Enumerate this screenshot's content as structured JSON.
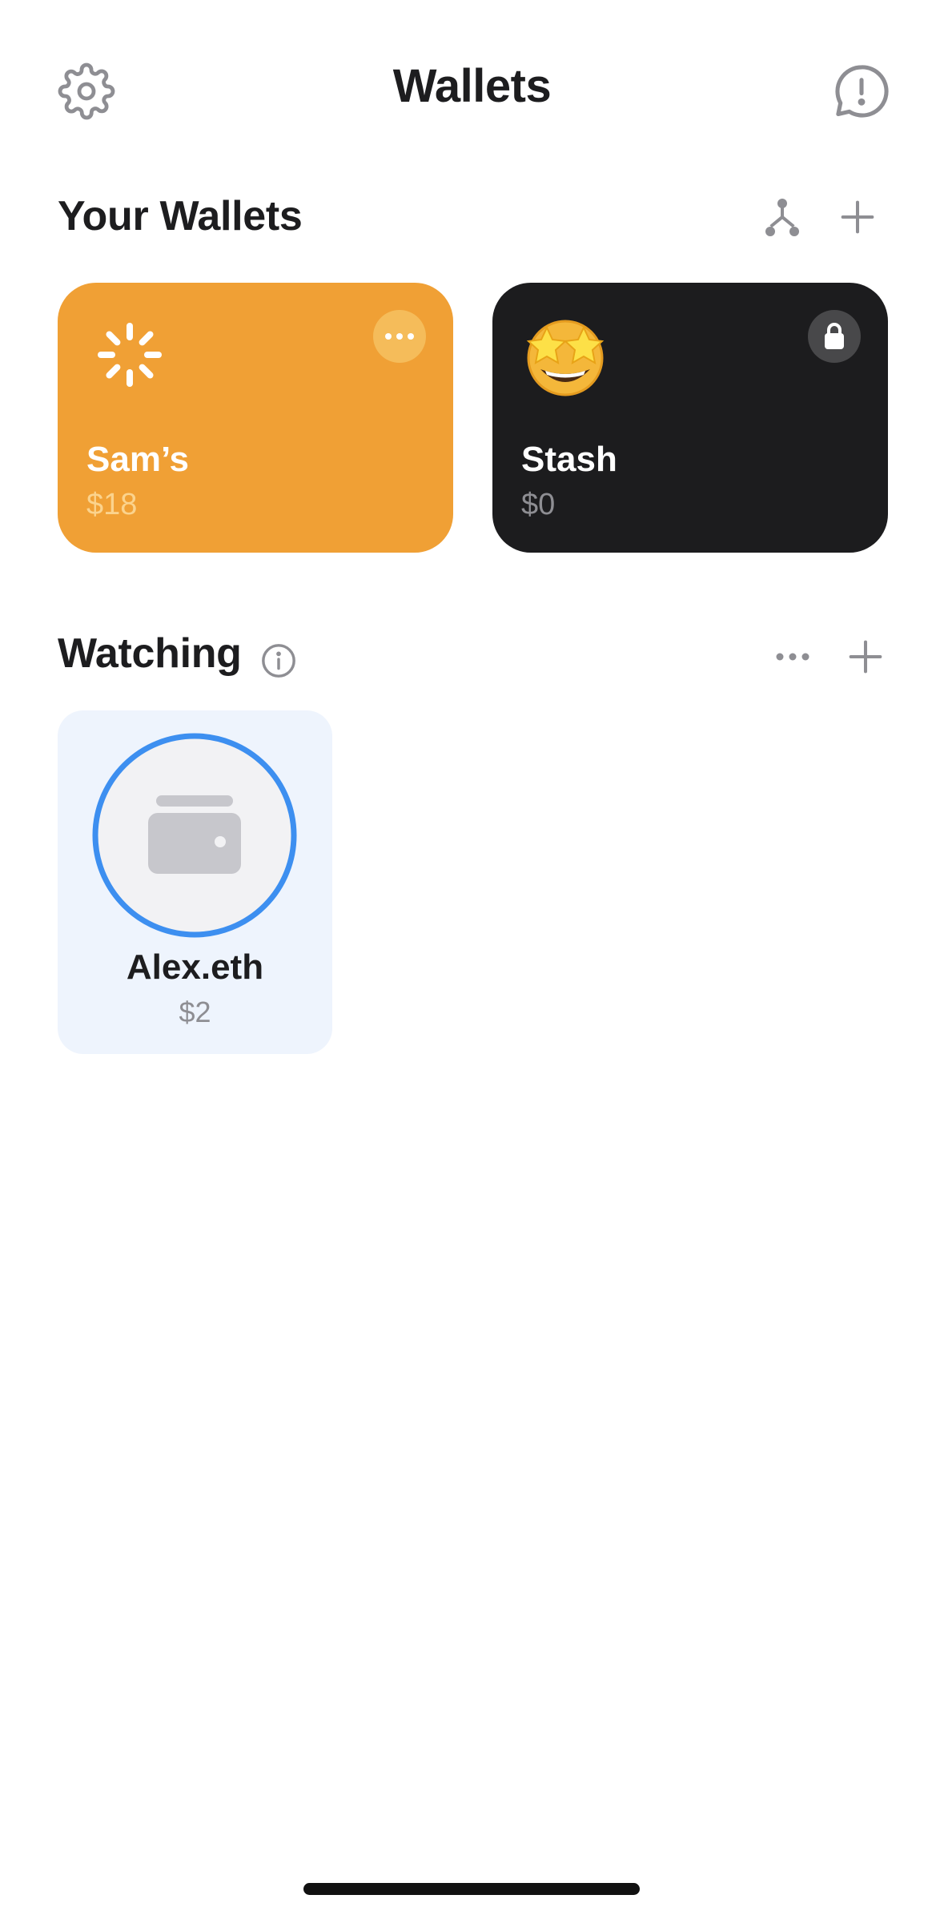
{
  "header": {
    "title": "Wallets",
    "left_icon": "gear-icon",
    "right_icon": "feedback-exclamation-icon"
  },
  "your_wallets": {
    "title": "Your Wallets",
    "actions": [
      "connect-hierarchy-icon",
      "plus-icon"
    ],
    "cards": [
      {
        "name": "Sam’s",
        "balance": "$18",
        "icon": "loading-spinner-icon",
        "menu_icon": "more-dots-icon",
        "bg_color": "#f0a035",
        "balance_color": "#fbd38d"
      },
      {
        "name": "Stash",
        "balance": "$0",
        "icon": "star-struck-emoji",
        "menu_icon": "lock-icon",
        "bg_color": "#1c1c1e",
        "balance_color": "#8e8e93"
      }
    ]
  },
  "watching": {
    "title": "Watching",
    "info_icon": "info-icon",
    "actions": [
      "more-dots-icon",
      "plus-icon"
    ],
    "items": [
      {
        "name": "Alex.eth",
        "balance": "$2",
        "icon": "wallet-icon",
        "ring_color": "#3d8ff0"
      }
    ]
  }
}
